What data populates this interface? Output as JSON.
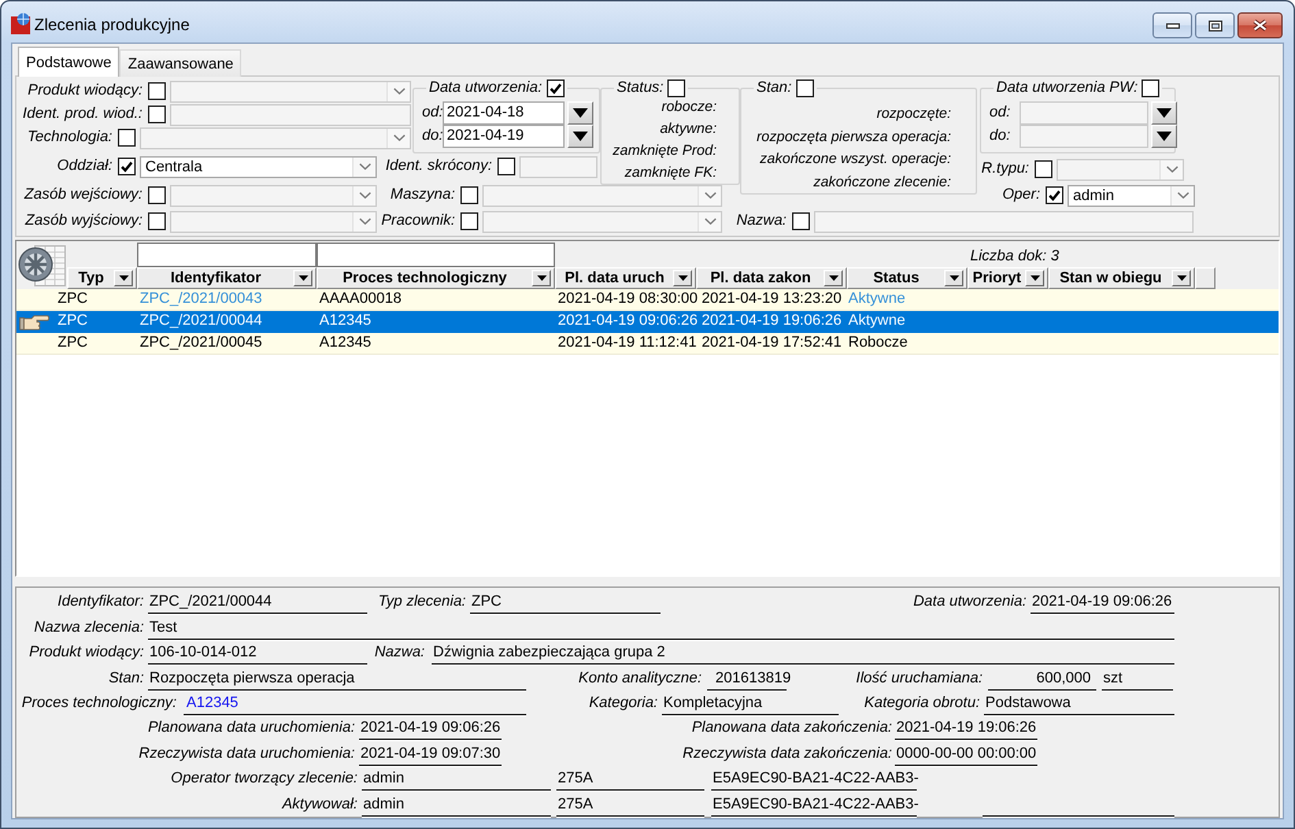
{
  "window": {
    "title": "Zlecenia produkcyjne"
  },
  "tabs": [
    {
      "label": "Podstawowe",
      "selected": true
    },
    {
      "label": "Zaawansowane",
      "selected": false
    }
  ],
  "filters": {
    "product": {
      "label": "Produkt wiodący:",
      "checked": false
    },
    "product_id": {
      "label": "Ident. prod. wiod.:",
      "checked": false
    },
    "technology": {
      "label": "Technologia:",
      "checked": false
    },
    "created": {
      "label": "Data utworzenia:",
      "checked": true,
      "from_label": "od:",
      "from": "2021-04-18",
      "to_label": "do:",
      "to": "2021-04-19"
    },
    "department": {
      "label": "Oddział:",
      "checked": true,
      "value": "Centrala"
    },
    "short_id": {
      "label": "Ident. skrócony:",
      "checked": false
    },
    "status": {
      "label": "Status:",
      "checked": false,
      "options": [
        "robocze:",
        "aktywne:",
        "zamknięte Prod:",
        "zamknięte FK:"
      ]
    },
    "state": {
      "label": "Stan:",
      "checked": false,
      "options": [
        "rozpoczęte:",
        "rozpoczęta pierwsza operacja:",
        "zakończone wszyst. operacje:",
        "zakończone zlecenie:"
      ]
    },
    "pw_created": {
      "label": "Data utworzenia PW:",
      "checked": false,
      "from_label": "od:",
      "to_label": "do:"
    },
    "doc_type": {
      "label": "R.typu:",
      "checked": false
    },
    "input_resource": {
      "label": "Zasób wejściowy:",
      "checked": false
    },
    "machine": {
      "label": "Maszyna:",
      "checked": false
    },
    "operator": {
      "label": "Oper:",
      "checked": true,
      "value": "admin"
    },
    "output_resource": {
      "label": "Zasób wyjściowy:",
      "checked": false
    },
    "worker": {
      "label": "Pracownik:",
      "checked": false
    },
    "name": {
      "label": "Nazwa:",
      "checked": false
    }
  },
  "table": {
    "count": "Liczba dok: 3",
    "columns": [
      {
        "label": "Typ",
        "filter_field": false
      },
      {
        "label": "Identyfikator",
        "filter_field": true
      },
      {
        "label": "Proces technologiczny",
        "filter_field": true
      },
      {
        "label": "Pl. data uruch",
        "filter_field": false
      },
      {
        "label": "Pl. data zakon",
        "filter_field": false
      },
      {
        "label": "Status",
        "filter_field": false
      },
      {
        "label": "Prioryt",
        "filter_field": false
      },
      {
        "label": "Stan w obiegu",
        "filter_field": false
      }
    ],
    "rows": [
      {
        "cells": [
          "ZPC",
          "ZPC_/2021/00043",
          "AAAA00018",
          "2021-04-19 08:30:00",
          "2021-04-19 13:23:20",
          "Aktywne"
        ],
        "kind": "active",
        "selected": false
      },
      {
        "cells": [
          "ZPC",
          "ZPC_/2021/00044",
          "A12345",
          "2021-04-19 09:06:26",
          "2021-04-19 19:06:26",
          "Aktywne"
        ],
        "kind": "active",
        "selected": true
      },
      {
        "cells": [
          "ZPC",
          "ZPC_/2021/00045",
          "A12345",
          "2021-04-19 11:12:41",
          "2021-04-19 17:52:41",
          "Robocze"
        ],
        "kind": "draft",
        "selected": false
      }
    ]
  },
  "details": {
    "id": {
      "label": "Identyfikator:",
      "value": "ZPC_/2021/00044"
    },
    "order_type": {
      "label": "Typ zlecenia:",
      "value": "ZPC"
    },
    "created": {
      "label": "Data utworzenia:",
      "value": "2021-04-19 09:06:26"
    },
    "order_name": {
      "label": "Nazwa zlecenia:",
      "value": "Test"
    },
    "product": {
      "label": "Produkt wiodący:",
      "value": "106-10-014-012"
    },
    "product_name": {
      "label": "Nazwa:",
      "value": "Dźwignia zabezpieczająca grupa 2"
    },
    "state": {
      "label": "Stan:",
      "value": "Rozpoczęta pierwsza operacja"
    },
    "account": {
      "label": "Konto analityczne:",
      "value": "201613819"
    },
    "quantity": {
      "label": "Ilość uruchamiana:",
      "value": "600,000",
      "unit": "szt"
    },
    "process": {
      "label": "Proces technologiczny:",
      "value": "A12345"
    },
    "category": {
      "label": "Kategoria:",
      "value": "Kompletacyjna"
    },
    "turnover_category": {
      "label": "Kategoria obrotu:",
      "value": "Podstawowa"
    },
    "planned_start": {
      "label": "Planowana data uruchomienia:",
      "value": "2021-04-19 09:06:26"
    },
    "planned_end": {
      "label": "Planowana data zakończenia:",
      "value": "2021-04-19 19:06:26"
    },
    "actual_start": {
      "label": "Rzeczywista data uruchomienia:",
      "value": "2021-04-19 09:07:30"
    },
    "actual_end": {
      "label": "Rzeczywista data zakończenia:",
      "value": "0000-00-00 00:00:00"
    },
    "creator": {
      "label": "Operator tworzący zlecenie:",
      "values": [
        "admin",
        "275A",
        "E5A9EC90-BA21-4C22-AAB3-"
      ]
    },
    "activator": {
      "label": "Aktywował:",
      "values": [
        "admin",
        "275A",
        "E5A9EC90-BA21-4C22-AAB3-"
      ]
    }
  }
}
